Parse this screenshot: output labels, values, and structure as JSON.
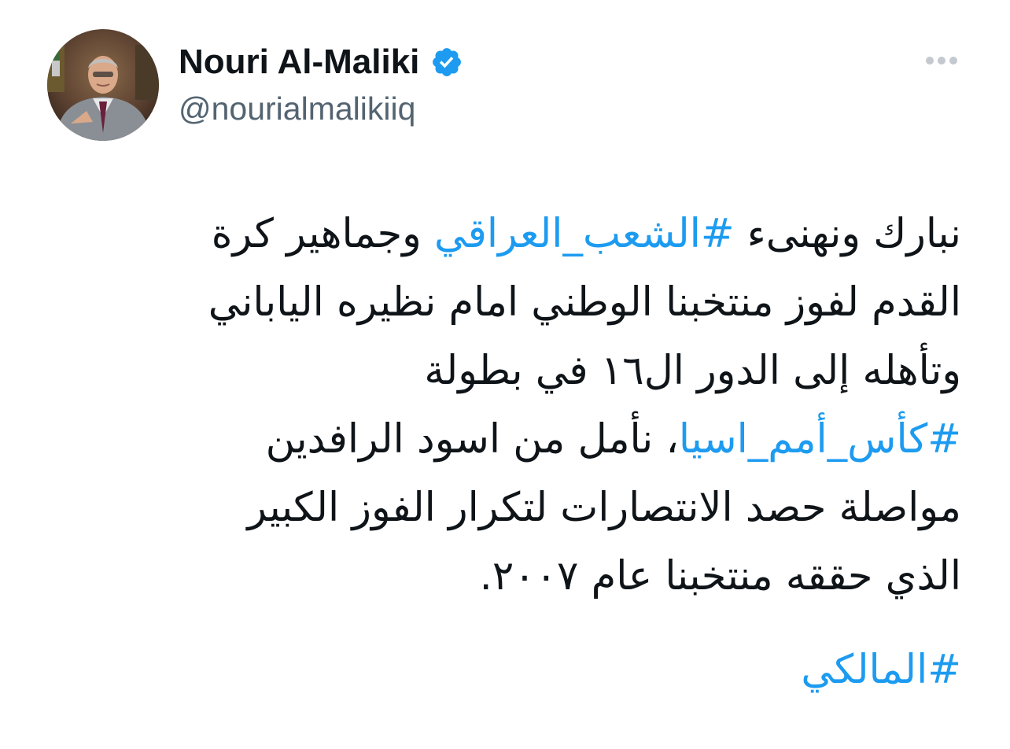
{
  "author": {
    "display_name": "Nouri Al-Maliki",
    "handle": "@nourialmalikiiq",
    "verified": true,
    "avatar_icon": "profile-photo"
  },
  "menu": {
    "icon": "more-horizontal-icon"
  },
  "tweet": {
    "line1": {
      "pre": "نبارك ونهنىء ",
      "tag": "#الشعب_العراقي",
      "post": " وجماهير كرة"
    },
    "line2": "القدم لفوز منتخبنا الوطني امام نظيره الياباني",
    "line3": "وتأهله إلى الدور ال١٦ في بطولة",
    "line4": {
      "tag": "#كأس_أمم_اسيا",
      "post": "، نأمل من اسود الرافدين"
    },
    "line5": "مواصلة حصد الانتصارات لتكرار الفوز الكبير",
    "line6": "الذي حققه منتخبنا عام ٢٠٠٧.",
    "bottom_hashtag": "#المالكي"
  },
  "colors": {
    "link": "#1d9bf0",
    "verified": "#1d9bf0",
    "text": "#0f1419",
    "secondary": "#536471"
  }
}
